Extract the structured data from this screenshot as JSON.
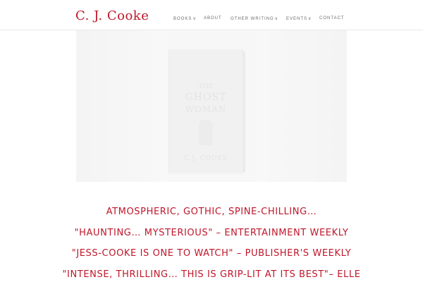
{
  "header": {
    "logo": "C. J. Cooke"
  },
  "nav": {
    "items": [
      {
        "label": "BOOKS",
        "has_dropdown": true
      },
      {
        "label": "ABOUT",
        "has_dropdown": false
      },
      {
        "label": "OTHER WRITING",
        "has_dropdown": true
      },
      {
        "label": "EVENTS",
        "has_dropdown": true
      },
      {
        "label": "CONTACT",
        "has_dropdown": false
      }
    ],
    "chevron": "∨"
  },
  "hero": {
    "book_cover_text": [
      "THE",
      "GHOST",
      "WOMAN",
      "C.J. COOKE"
    ]
  },
  "quotes": [
    "ATMOSPHERIC, GOTHIC, SPINE-CHILLING…",
    "\"HAUNTING… MYSTERIOUS\" – ENTERTAINMENT WEEKLY",
    "\"JESS-COOKE IS ONE TO WATCH\" – PUBLISHER'S WEEKLY",
    "\"INTENSE, THRILLING… THIS IS GRIP-LIT AT ITS BEST\"– ELLE"
  ],
  "colors": {
    "accent": "#c0162a",
    "nav_text": "#6b6b6b"
  }
}
